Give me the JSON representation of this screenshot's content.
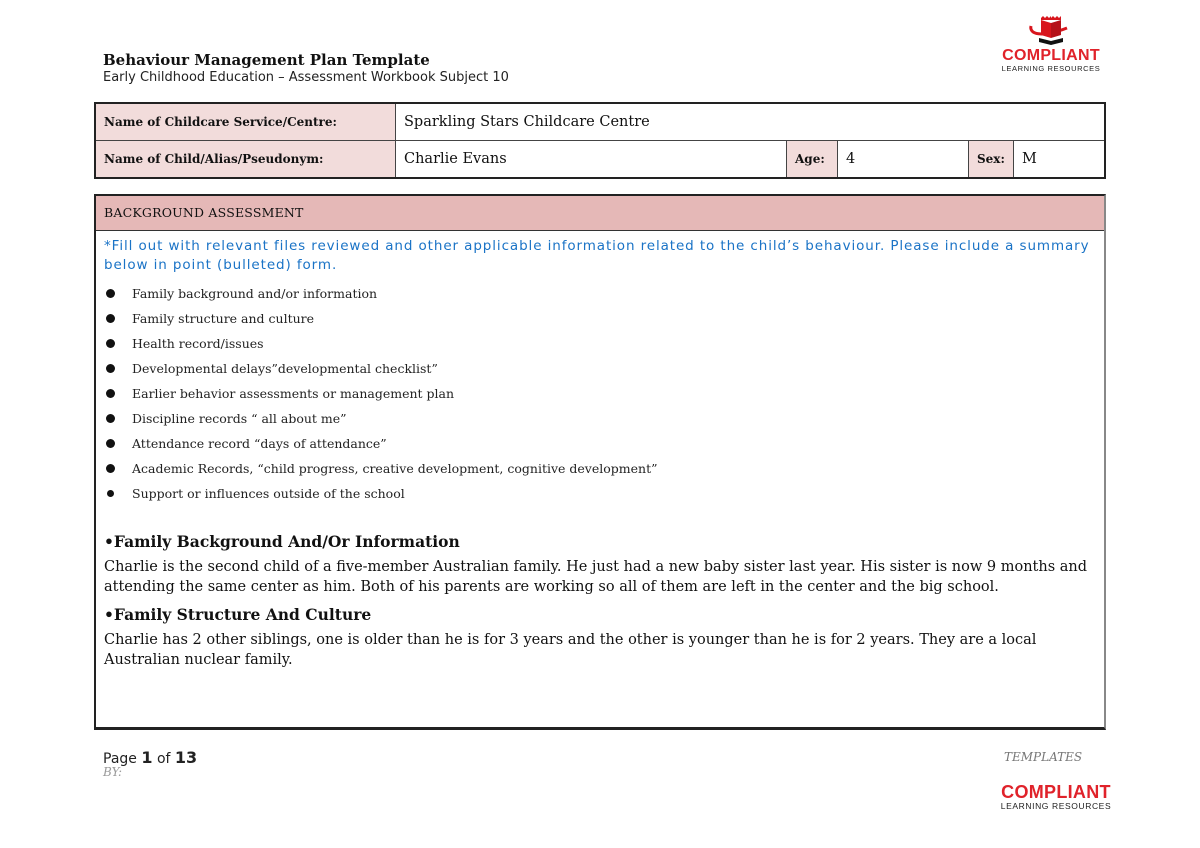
{
  "header": {
    "title": "Behaviour Management Plan Template",
    "subtitle": "Early Childhood Education – Assessment Workbook Subject 10",
    "logo": {
      "icon": "book-swoosh-icon",
      "word": "COMPLIANT",
      "sub": "LEARNING RESOURCES",
      "brand_color": "#e0222a"
    }
  },
  "info_table": {
    "service_label": "Name of Childcare Service/Centre:",
    "service_value": "Sparkling Stars Childcare Centre",
    "child_label": "Name of Child/Alias/Pseudonym:",
    "child_value": "Charlie Evans",
    "age_label": "Age:",
    "age_value": "4",
    "sex_label": "Sex:",
    "sex_value": "M",
    "label_bg": "#f2dcdb"
  },
  "background": {
    "header": "BACKGROUND ASSESSMENT",
    "header_bg": "#e5b8b7",
    "instruction": "*Fill out with relevant files reviewed and other applicable information related to the child’s behaviour. Please include a summary below in point (bulleted) form.",
    "instruction_color": "#1a73c6",
    "bullets": [
      "Family background and/or information",
      "Family structure and culture",
      "Health record/issues",
      "Developmental delays”developmental checklist”",
      "Earlier behavior assessments or management plan",
      "Discipline records “ all about me”",
      "Attendance record “days of attendance”",
      "Academic Records, “child progress, creative development, cognitive development”",
      "Support or influences outside of the school"
    ],
    "sections": [
      {
        "heading": "•Family Background And/Or Information",
        "text": "Charlie is the second child of a five-member Australian family. He just had a new baby sister last year. His sister is now 9 months and attending the same center as him. Both of his parents are working so all of them are left in the center and the big school."
      },
      {
        "heading": "•Family Structure And Culture",
        "text": "Charlie has 2 other siblings, one is older than he is for 3 years and the other is younger than he is for 2 years. They are a local Australian nuclear family."
      }
    ]
  },
  "footer": {
    "page_prefix": "Page",
    "page_current": "1",
    "page_of": "of",
    "page_total": "13",
    "by": "BY:",
    "templates": "TEMPLATES",
    "logo_word": "COMPLIANT",
    "logo_sub": "LEARNING RESOURCES"
  }
}
